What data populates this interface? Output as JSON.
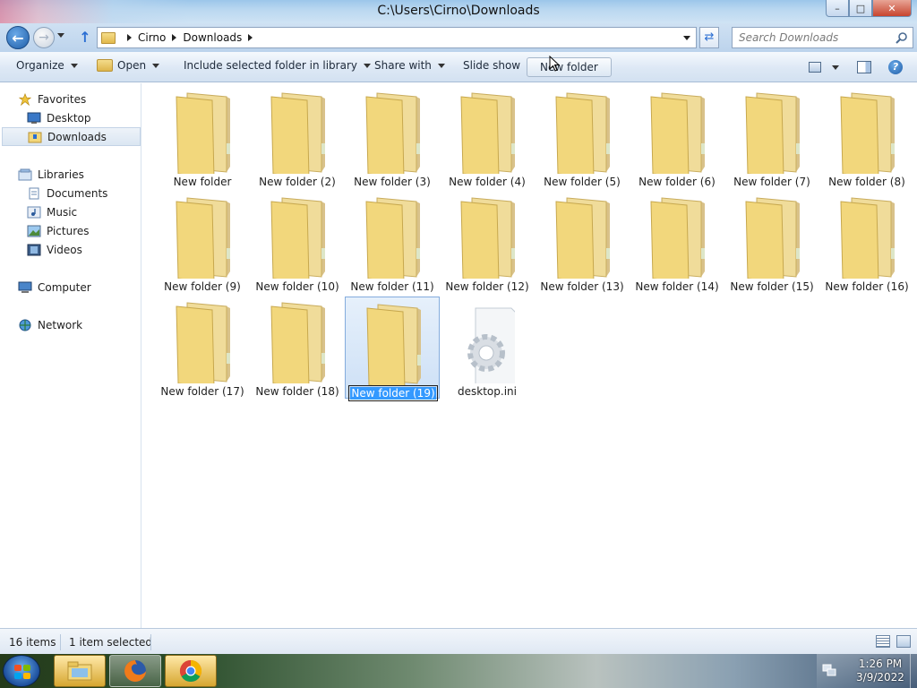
{
  "window": {
    "title": "C:\\Users\\Cirno\\Downloads"
  },
  "address": {
    "crumbs": [
      "Cirno",
      "Downloads"
    ],
    "search_placeholder": "Search Downloads"
  },
  "toolbar": {
    "organize": "Organize",
    "open": "Open",
    "include": "Include selected folder in library",
    "share": "Share with",
    "slideshow": "Slide show",
    "new_folder": "New folder"
  },
  "sidebar": {
    "favorites": "Favorites",
    "desktop": "Desktop",
    "downloads": "Downloads",
    "libraries": "Libraries",
    "documents": "Documents",
    "music": "Music",
    "pictures": "Pictures",
    "videos": "Videos",
    "computer": "Computer",
    "network": "Network"
  },
  "items": [
    "New folder",
    "New folder (2)",
    "New folder (3)",
    "New folder (4)",
    "New folder (5)",
    "New folder (6)",
    "New folder (7)",
    "New folder (8)",
    "New folder (9)",
    "New folder (10)",
    "New folder (11)",
    "New folder (12)",
    "New folder (13)",
    "New folder (14)",
    "New folder (15)",
    "New folder (16)",
    "New folder (17)",
    "New folder (18)",
    "New folder (19)",
    "desktop.ini"
  ],
  "status": {
    "count": "16 items",
    "selection": "1 item selected"
  },
  "taskbar": {
    "time": "1:26 PM",
    "date": "3/9/2022"
  },
  "colors": {
    "selection": "#3399ff",
    "folder": "#f2d77c"
  }
}
